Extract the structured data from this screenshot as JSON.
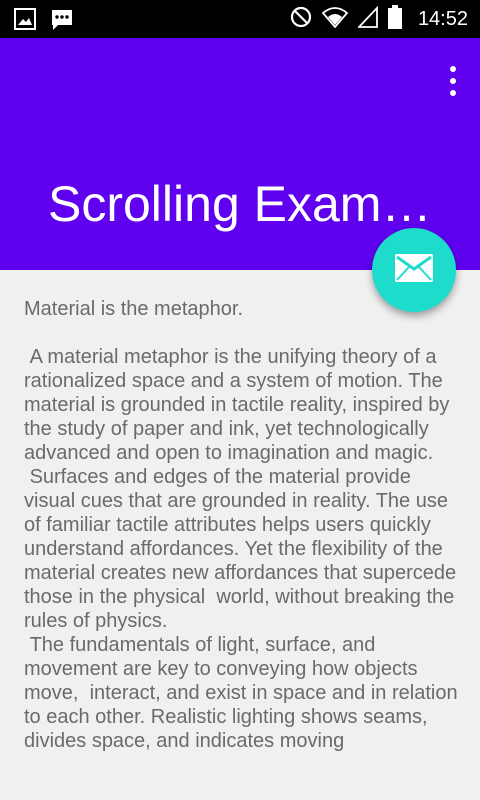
{
  "status_bar": {
    "time": "14:52",
    "left_icons": [
      "image-icon",
      "chat-icon"
    ],
    "right_icons": [
      "do-not-disturb-icon",
      "wifi-icon",
      "signal-icon",
      "battery-icon"
    ]
  },
  "app_bar": {
    "title": "Scrolling Exam…",
    "color": "#5f00ef"
  },
  "fab": {
    "icon": "mail-icon",
    "color": "#1ddccb"
  },
  "content": {
    "text": "Material is the metaphor.\n\n A material metaphor is the unifying theory of a rationalized space and a system of motion. The material is grounded in tactile reality, inspired by the study of paper and ink, yet technologically advanced and open to imagination and magic.\n Surfaces and edges of the material provide visual cues that are grounded in reality. The use of familiar tactile attributes helps users quickly understand affordances. Yet the flexibility of the material creates new affordances that supercede those in the physical  world, without breaking the rules of physics.\n The fundamentals of light, surface, and movement are key to conveying how objects move,  interact, and exist in space and in relation to each other. Realistic lighting shows seams, divides space, and indicates moving"
  }
}
